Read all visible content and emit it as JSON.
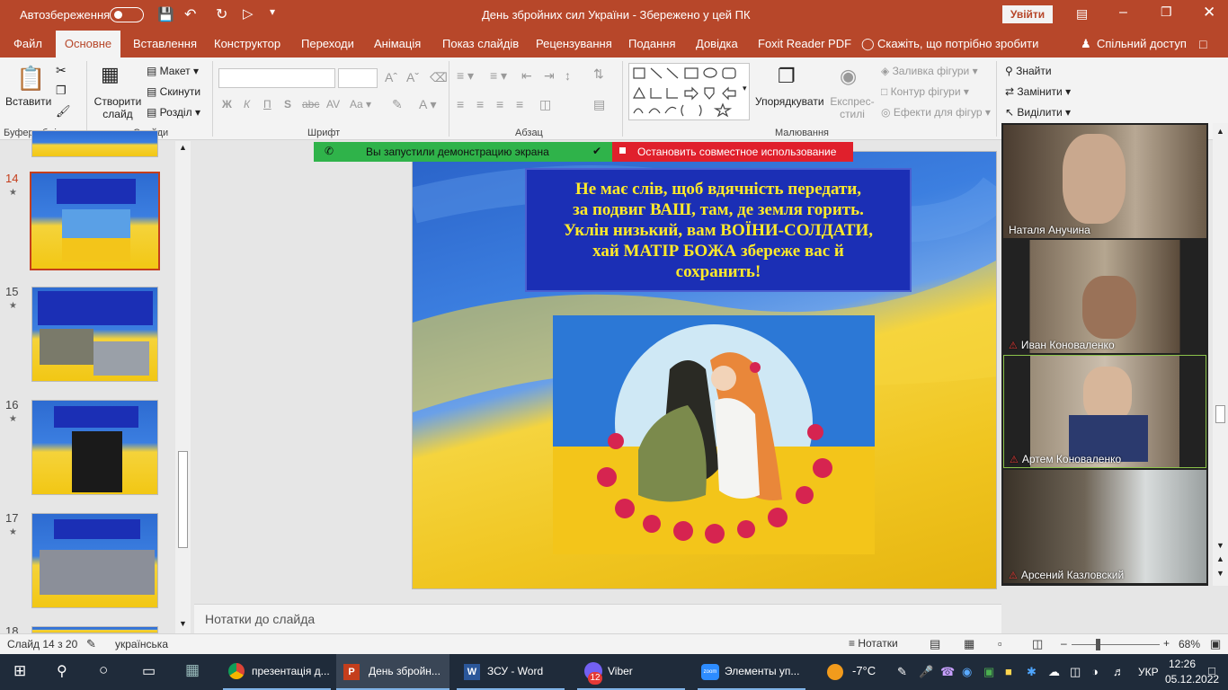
{
  "titlebar": {
    "autosave_label": "Автозбереження",
    "autosave_state": "Вимк.",
    "doc_title": "День збройних сил України  -  Збережено у цей ПК",
    "signin_button": "Увійти"
  },
  "tabs": [
    "Файл",
    "Основне",
    "Вставлення",
    "Конструктор",
    "Переходи",
    "Анімація",
    "Показ слайдів",
    "Рецензування",
    "Подання",
    "Довідка",
    "Foxit Reader PDF",
    "Скажіть, що потрібно зробити",
    "Спільний доступ"
  ],
  "ribbon": {
    "groups": [
      "Буфер обміну",
      "Слайди",
      "Шрифт",
      "Абзац",
      "Малювання"
    ],
    "paste_label": "Вставити",
    "new_slide_label": "Створити слайд",
    "layout_label": "Макет",
    "reset_label": "Скинути",
    "section_label": "Розділ",
    "arrange_label": "Упорядкувати",
    "quick_styles_label": "Експрес-стилі",
    "shape_fill": "Заливка фігури",
    "shape_outline": "Контур фігури",
    "shape_effects": "Ефекти для фігур",
    "find_label": "Знайти",
    "replace_label": "Замінити",
    "select_label": "Виділити",
    "font_bold": "Ж",
    "font_italic": "К",
    "font_underline": "П",
    "font_strike": "abc"
  },
  "slides": [
    {
      "num": "14"
    },
    {
      "num": "15"
    },
    {
      "num": "16"
    },
    {
      "num": "17"
    },
    {
      "num": "18"
    }
  ],
  "share_bar": {
    "running": "Вы запустили демонстрацию экрана",
    "stop": "Остановить совместное использование"
  },
  "slide": {
    "poem": [
      "Не має слів, щоб вдячність передати,",
      "за подвиг ВАШ, там, де земля горить.",
      "Уклін низький, вам ВОЇНИ-СОЛДАТИ,",
      "хай МАТІР БОЖА збереже вас й",
      "сохранить!"
    ]
  },
  "notes_placeholder": "Нотатки до слайда",
  "participants": [
    {
      "name": "Наталя Анучина",
      "muted": false
    },
    {
      "name": "Иван Коноваленко",
      "muted": true
    },
    {
      "name": "Артем Коноваленко",
      "muted": true
    },
    {
      "name": "Арсений Казловский",
      "muted": true
    }
  ],
  "status": {
    "slide_counter": "Слайд 14 з 20",
    "language": "українська",
    "notes_button": "Нотатки",
    "zoom": "68%"
  },
  "taskbar": {
    "items": [
      "презентація д...",
      "День збройн...",
      "ЗСУ - Word",
      "Viber",
      "Элементы уп..."
    ],
    "viber_badge": "12",
    "weather": "-7°C",
    "lang": "УКР",
    "time": "12:26",
    "date": "05.12.2022"
  },
  "colors": {
    "accent": "#b7472a",
    "share_green": "#2fb34a",
    "share_red": "#e0202c",
    "poem_bg": "#1b2fb5",
    "poem_text": "#ffea2a"
  }
}
